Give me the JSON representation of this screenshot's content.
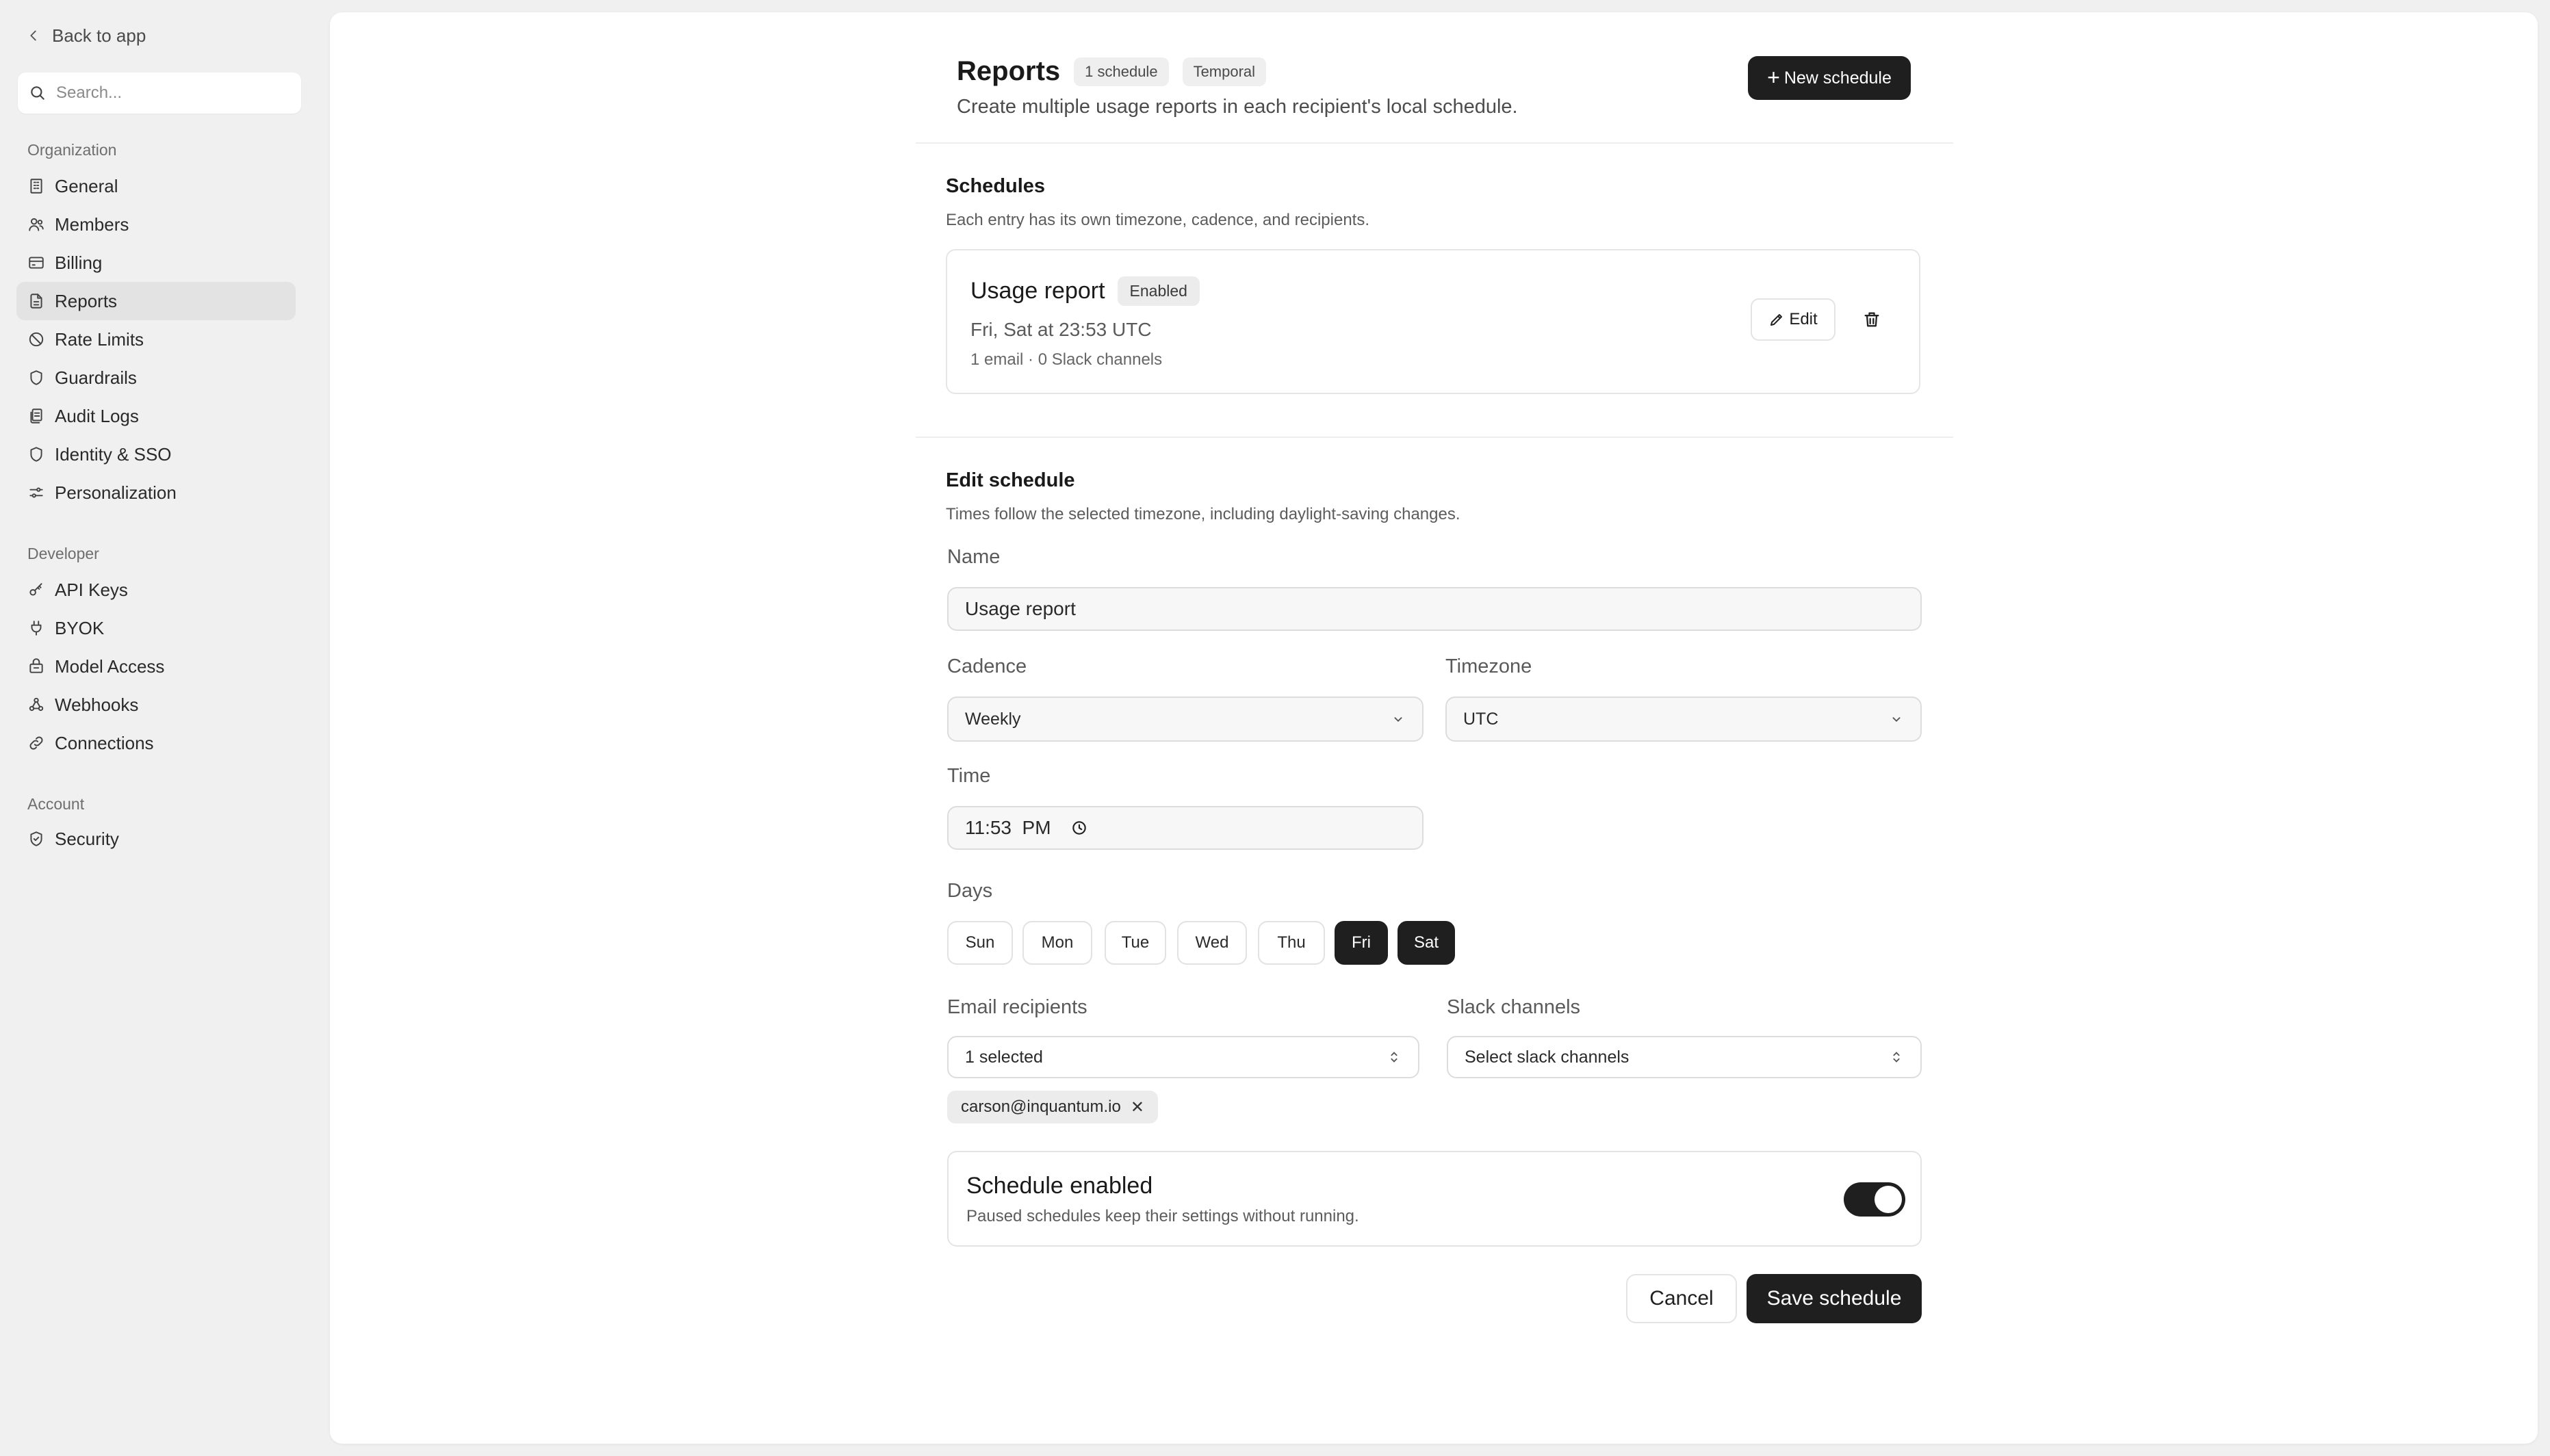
{
  "sidebar": {
    "back_label": "Back to app",
    "search_placeholder": "Search...",
    "sections": {
      "organization": {
        "title": "Organization",
        "items": [
          {
            "label": "General",
            "icon": "building-icon"
          },
          {
            "label": "Members",
            "icon": "users-icon"
          },
          {
            "label": "Billing",
            "icon": "credit-card-icon"
          },
          {
            "label": "Reports",
            "icon": "file-icon",
            "active": true
          },
          {
            "label": "Rate Limits",
            "icon": "ban-icon"
          },
          {
            "label": "Guardrails",
            "icon": "shield-icon"
          },
          {
            "label": "Audit Logs",
            "icon": "audit-icon"
          },
          {
            "label": "Identity & SSO",
            "icon": "shield-icon"
          },
          {
            "label": "Personalization",
            "icon": "sliders-icon"
          }
        ]
      },
      "developer": {
        "title": "Developer",
        "items": [
          {
            "label": "API Keys",
            "icon": "key-icon"
          },
          {
            "label": "BYOK",
            "icon": "plug-icon"
          },
          {
            "label": "Model Access",
            "icon": "box-icon"
          },
          {
            "label": "Webhooks",
            "icon": "webhook-icon"
          },
          {
            "label": "Connections",
            "icon": "link-icon"
          }
        ]
      },
      "account": {
        "title": "Account",
        "items": [
          {
            "label": "Security",
            "icon": "shield-check-icon"
          }
        ]
      }
    }
  },
  "header": {
    "title": "Reports",
    "badge_count": "1 schedule",
    "badge_engine": "Temporal",
    "subtitle": "Create multiple usage reports in each recipient's local schedule.",
    "new_button": "New schedule"
  },
  "schedules": {
    "title": "Schedules",
    "subtitle": "Each entry has its own timezone, cadence, and recipients.",
    "card": {
      "name": "Usage report",
      "status": "Enabled",
      "when": "Fri, Sat at 23:53 UTC",
      "meta": "1 email · 0 Slack channels",
      "edit_label": "Edit"
    }
  },
  "edit": {
    "title": "Edit schedule",
    "subtitle": "Times follow the selected timezone, including daylight-saving changes.",
    "name_label": "Name",
    "name_value": "Usage report",
    "cadence_label": "Cadence",
    "cadence_value": "Weekly",
    "timezone_label": "Timezone",
    "timezone_value": "UTC",
    "time_label": "Time",
    "time_value": "11:53  PM",
    "days_label": "Days",
    "days": [
      {
        "label": "Sun",
        "selected": false
      },
      {
        "label": "Mon",
        "selected": false
      },
      {
        "label": "Tue",
        "selected": false
      },
      {
        "label": "Wed",
        "selected": false
      },
      {
        "label": "Thu",
        "selected": false
      },
      {
        "label": "Fri",
        "selected": true
      },
      {
        "label": "Sat",
        "selected": true
      }
    ],
    "email_label": "Email recipients",
    "email_value": "1 selected",
    "email_chip": "carson@inquantum.io",
    "slack_label": "Slack channels",
    "slack_value": "Select slack channels",
    "toggle_title": "Schedule enabled",
    "toggle_sub": "Paused schedules keep their settings without running.",
    "toggle_on": true,
    "cancel_label": "Cancel",
    "save_label": "Save schedule"
  },
  "colors": {
    "background": "#f0f0f0",
    "panel": "#ffffff",
    "dark_button": "#1f1f1f",
    "active_nav": "#e3e3e3"
  }
}
